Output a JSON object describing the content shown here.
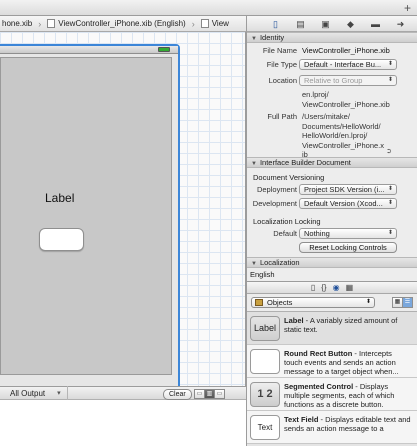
{
  "window": {
    "add_symbol": "+"
  },
  "jumpbar": {
    "crumb1": "hone.xib",
    "crumb2": "ViewController_iPhone.xib (English)",
    "crumb3": "View"
  },
  "inspector_toolbar": {
    "icons": [
      "file-inspector-icon",
      "quick-help-icon",
      "identity-inspector-icon",
      "attributes-inspector-icon",
      "size-inspector-icon",
      "connections-inspector-icon"
    ]
  },
  "canvas": {
    "label_text": "Label"
  },
  "identity": {
    "header": "Identity",
    "file_name_key": "File Name",
    "file_name_value": "ViewController_iPhone.xib",
    "file_type_key": "File Type",
    "file_type_value": "Default - Interface Bu...",
    "location_key": "Location",
    "location_value": "Relative to Group",
    "location_path_1": "en.lproj/",
    "location_path_2": "ViewController_iPhone.xib",
    "full_path_key": "Full Path",
    "full_path_1": "/Users/mitake/",
    "full_path_2": "Documents/HelloWorld/",
    "full_path_3": "HelloWorld/en.lproj/",
    "full_path_4": "ViewController_iPhone.x",
    "full_path_5": "ib"
  },
  "ib_document": {
    "header": "Interface Builder Document",
    "versioning_title": "Document Versioning",
    "deployment_key": "Deployment",
    "deployment_value": "Project SDK Version (i...",
    "development_key": "Development",
    "development_value": "Default Version (Xcod...",
    "localization_locking_title": "Localization Locking",
    "default_key": "Default",
    "default_value": "Nothing",
    "reset_button": "Reset Locking Controls"
  },
  "localization": {
    "header": "Localization",
    "language": "English"
  },
  "library": {
    "objects_label": "Objects",
    "items": [
      {
        "thumb": "Label",
        "name": "Label",
        "desc": " - A variably sized amount of static text."
      },
      {
        "thumb": "",
        "name": "Round Rect Button",
        "desc": " - Intercepts touch events and sends an action message to a target object when..."
      },
      {
        "thumb": "1 2",
        "name": "Segmented Control",
        "desc": " - Displays multiple segments, each of which functions as a discrete button."
      },
      {
        "thumb": "Text",
        "name": "Text Field",
        "desc": " - Displays editable text and sends an action message to a"
      }
    ]
  },
  "output": {
    "selector": "All Output",
    "clear_button": "Clear"
  },
  "colors": {
    "selection_blue": "#3c86d8",
    "view_gray": "#c8c8c8"
  }
}
